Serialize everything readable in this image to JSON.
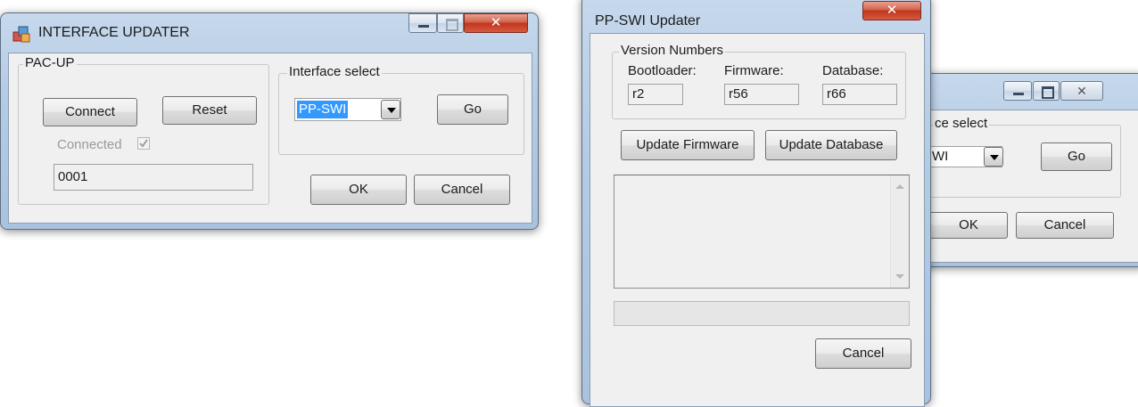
{
  "window1": {
    "title": "INTERFACE UPDATER",
    "icon": "app-icon",
    "pac_group": {
      "label": "PAC-UP",
      "connect_label": "Connect",
      "reset_label": "Reset",
      "connected_label": "Connected",
      "connected_checked": true,
      "id_value": "0001"
    },
    "interface_group": {
      "label": "Interface select",
      "selected": "PP-SWI",
      "go_label": "Go"
    },
    "ok_label": "OK",
    "cancel_label": "Cancel"
  },
  "window2": {
    "title": "PP-SWI Updater",
    "versions": {
      "label": "Version Numbers",
      "bootloader_label": "Bootloader:",
      "bootloader_value": "r2",
      "firmware_label": "Firmware:",
      "firmware_value": "r56",
      "database_label": "Database:",
      "database_value": "r66"
    },
    "update_firmware_label": "Update Firmware",
    "update_database_label": "Update Database",
    "cancel_label": "Cancel"
  },
  "window3": {
    "group_label": "ce select",
    "selected": "WI",
    "go_label": "Go",
    "ok_label": "OK",
    "cancel_label": "Cancel"
  },
  "colors": {
    "frame": "#b4cbe4",
    "close_button": "#c2351b",
    "selection": "#3399ff",
    "dialog_bg": "#f0f0f0"
  }
}
